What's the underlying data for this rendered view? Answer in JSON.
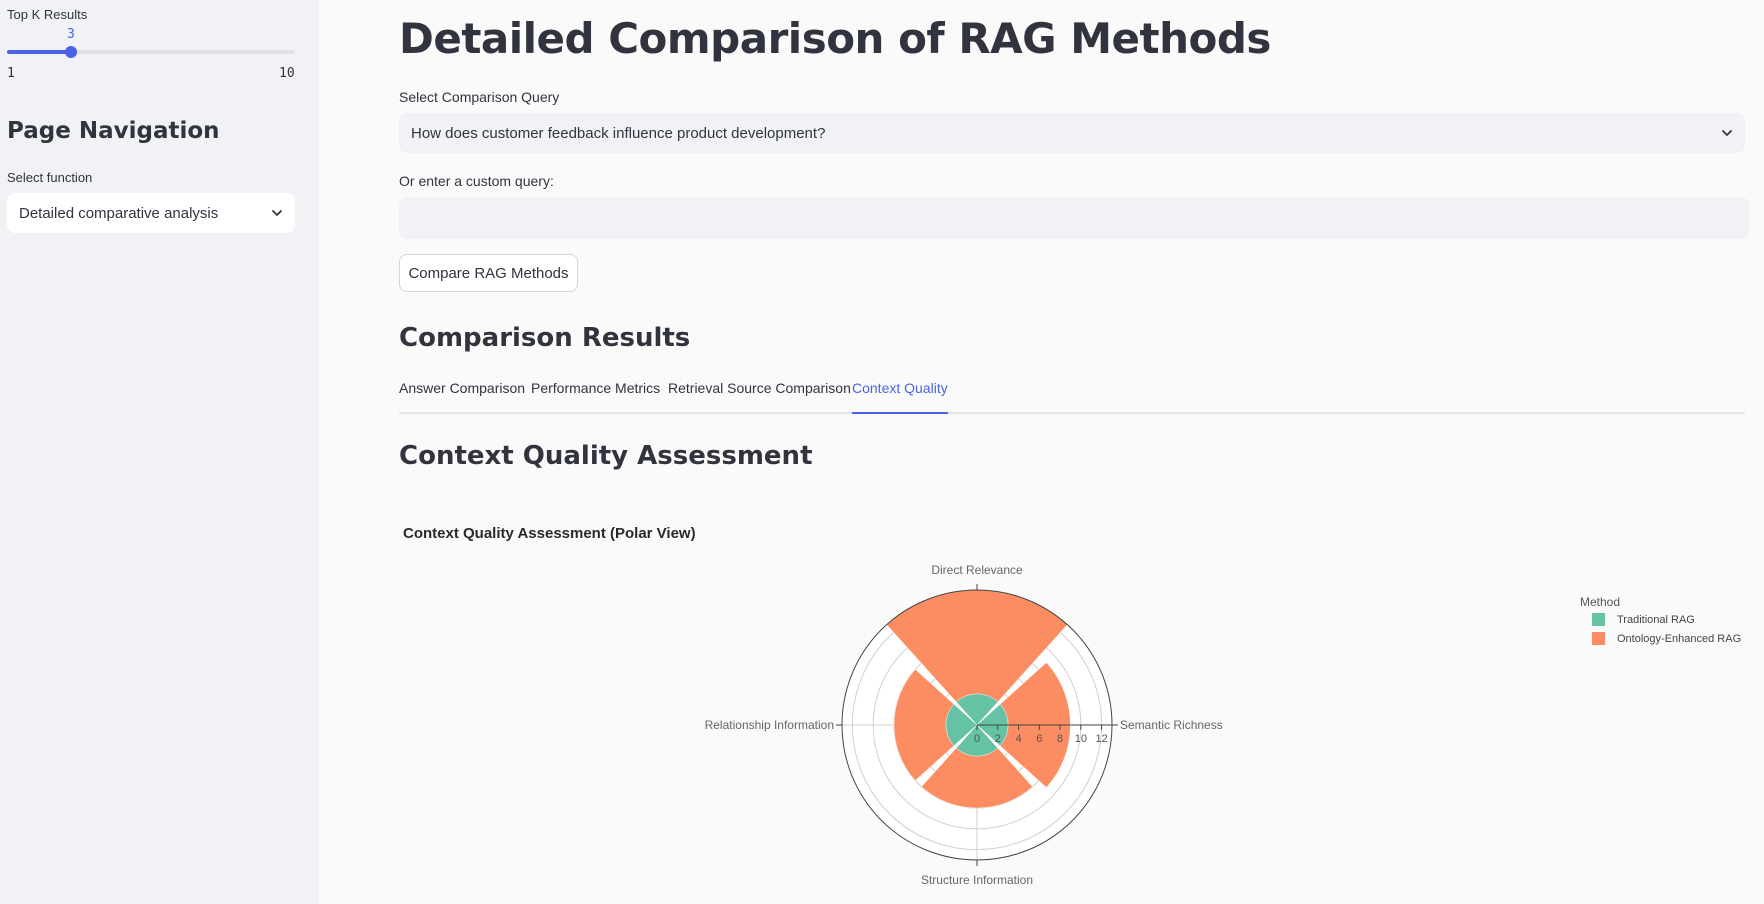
{
  "sidebar": {
    "top_k": {
      "label": "Top K Results",
      "value": 3,
      "min": 1,
      "max": 10,
      "value_text": "3",
      "min_text": "1",
      "max_text": "10"
    },
    "nav_title": "Page Navigation",
    "function_label": "Select function",
    "function_value": "Detailed comparative analysis"
  },
  "main": {
    "title": "Detailed Comparison of RAG Methods",
    "query_label": "Select Comparison Query",
    "query_value": "How does customer feedback influence product development?",
    "custom_label": "Or enter a custom query:",
    "custom_value": "",
    "compare_button": "Compare RAG Methods",
    "results_title": "Comparison Results",
    "tabs": [
      {
        "label": "Answer Comparison",
        "active": false
      },
      {
        "label": "Performance Metrics",
        "active": false
      },
      {
        "label": "Retrieval Source Comparison",
        "active": false
      },
      {
        "label": "Context Quality",
        "active": true
      }
    ],
    "section_title": "Context Quality Assessment"
  },
  "colors": {
    "accent": "#4a63e6",
    "traditional": "#66c2a5",
    "ontology": "#fc8d62"
  },
  "chart_data": {
    "type": "barpolar",
    "title": "Context Quality Assessment (Polar View)",
    "categories": [
      "Direct Relevance",
      "Semantic Richness",
      "Structure Information",
      "Relationship Information"
    ],
    "radial_ticks": [
      "0",
      "2",
      "4",
      "6",
      "8",
      "10",
      "12"
    ],
    "radial_range": [
      0,
      13
    ],
    "legend_title": "Method",
    "series": [
      {
        "name": "Traditional RAG",
        "values": [
          3,
          3,
          3,
          3
        ]
      },
      {
        "name": "Ontology-Enhanced RAG",
        "values": [
          13,
          9,
          8,
          8
        ]
      }
    ]
  }
}
